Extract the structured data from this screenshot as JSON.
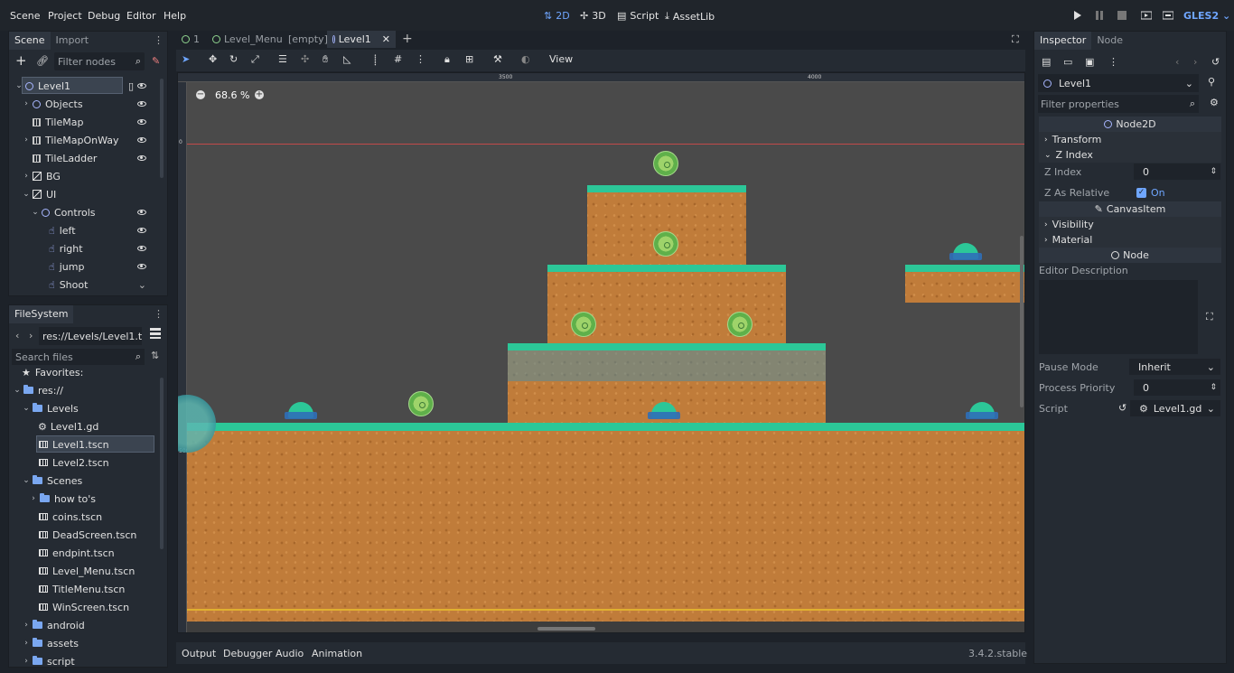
{
  "menus": [
    "Scene",
    "Project",
    "Debug",
    "Editor",
    "Help"
  ],
  "modes": [
    {
      "label": "2D",
      "icon": "2d-icon"
    },
    {
      "label": "3D",
      "icon": "3d-icon"
    },
    {
      "label": "Script",
      "icon": "script-icon"
    },
    {
      "label": "AssetLib",
      "icon": "assetlib-icon"
    }
  ],
  "renderer": "GLES2",
  "scene_dock": {
    "tabs": [
      "Scene",
      "Import"
    ],
    "filter_placeholder": "Filter nodes",
    "nodes": [
      {
        "label": "Level1",
        "icon": "node2d-icon"
      },
      {
        "label": "Objects",
        "icon": "node2d-icon"
      },
      {
        "label": "TileMap",
        "icon": "tilemap-icon"
      },
      {
        "label": "TileMapOnWay",
        "icon": "tilemap-icon"
      },
      {
        "label": "TileLadder",
        "icon": "tilemap-icon"
      },
      {
        "label": "BG",
        "icon": "parallax-icon"
      },
      {
        "label": "UI",
        "icon": "canvas-layer-icon"
      },
      {
        "label": "Controls",
        "icon": "node2d-icon"
      },
      {
        "label": "left",
        "icon": "touch-button-icon"
      },
      {
        "label": "right",
        "icon": "touch-button-icon"
      },
      {
        "label": "jump",
        "icon": "touch-button-icon"
      },
      {
        "label": "Shoot",
        "icon": "touch-button-icon"
      }
    ]
  },
  "filesystem": {
    "title": "FileSystem",
    "path": "res://Levels/Level1.tsc",
    "search_placeholder": "Search files",
    "items": [
      {
        "label": "Favorites:",
        "icon": "star-icon"
      },
      {
        "label": "res://",
        "icon": "folder-icon"
      },
      {
        "label": "Levels",
        "icon": "folder-icon"
      },
      {
        "label": "Level1.gd",
        "icon": "gear-icon"
      },
      {
        "label": "Level1.tscn",
        "icon": "scene-file-icon"
      },
      {
        "label": "Level2.tscn",
        "icon": "scene-file-icon"
      },
      {
        "label": "Scenes",
        "icon": "folder-icon"
      },
      {
        "label": "how to's",
        "icon": "folder-icon"
      },
      {
        "label": "coins.tscn",
        "icon": "scene-file-icon"
      },
      {
        "label": "DeadScreen.tscn",
        "icon": "scene-file-icon"
      },
      {
        "label": "endpint.tscn",
        "icon": "scene-file-icon"
      },
      {
        "label": "Level_Menu.tscn",
        "icon": "scene-file-icon"
      },
      {
        "label": "TitleMenu.tscn",
        "icon": "scene-file-icon"
      },
      {
        "label": "WinScreen.tscn",
        "icon": "scene-file-icon"
      },
      {
        "label": "android",
        "icon": "folder-icon"
      },
      {
        "label": "assets",
        "icon": "folder-icon"
      },
      {
        "label": "script",
        "icon": "folder-icon"
      }
    ]
  },
  "scene_tabs": [
    "1",
    "Level_Menu",
    "[empty]",
    "Level1"
  ],
  "toolbar": {
    "view_label": "View"
  },
  "viewport": {
    "zoom": "68.6 %",
    "ruler_marks": [
      "3500",
      "4000"
    ],
    "ruler_left_marks": [
      "0",
      "500"
    ]
  },
  "bottom_tabs": [
    "Output",
    "Debugger",
    "Audio",
    "Animation"
  ],
  "version": "3.4.2.stable",
  "inspector": {
    "tabs": [
      "Inspector",
      "Node"
    ],
    "object": "Level1",
    "filter_placeholder": "Filter properties",
    "sections": {
      "node2d": "Node2D",
      "transform": "Transform",
      "zindex_group": "Z Index",
      "zindex_label": "Z Index",
      "zindex_value": "0",
      "zrel_label": "Z As Relative",
      "zrel_value": "On",
      "canvasitem": "CanvasItem",
      "visibility": "Visibility",
      "material": "Material",
      "node": "Node",
      "editor_description": "Editor Description",
      "pause_label": "Pause Mode",
      "pause_value": "Inherit",
      "priority_label": "Process Priority",
      "priority_value": "0",
      "script_label": "Script",
      "script_value": "Level1.gd"
    }
  },
  "colors": {
    "accent": "#6fa6ff",
    "grass": "#2cc798",
    "dirt": "#c07c3a"
  }
}
